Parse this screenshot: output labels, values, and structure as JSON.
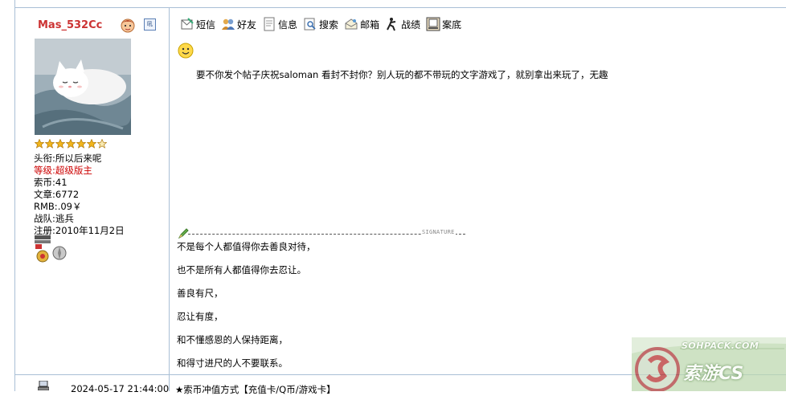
{
  "user": {
    "name": "Mas_532Cc",
    "stars": 7,
    "fields": [
      {
        "label": "头衔:",
        "value": "所以后来呢"
      },
      {
        "label": "等级:",
        "value": "超级版主"
      },
      {
        "label": "索币:",
        "value": "41"
      },
      {
        "label": "文章:",
        "value": "6772"
      },
      {
        "label": "RMB:",
        "value": ".09￥"
      },
      {
        "label": "战队:",
        "value": "逃兵"
      },
      {
        "label": "注册:",
        "value": "2010年11月2日"
      }
    ]
  },
  "toolbar": {
    "items": [
      {
        "label": "短信",
        "icon": "message-icon"
      },
      {
        "label": "好友",
        "icon": "friends-icon"
      },
      {
        "label": "信息",
        "icon": "info-icon"
      },
      {
        "label": "搜索",
        "icon": "search-icon"
      },
      {
        "label": "邮箱",
        "icon": "mail-icon"
      },
      {
        "label": "战绩",
        "icon": "record-icon"
      },
      {
        "label": "案底",
        "icon": "file-icon"
      }
    ]
  },
  "post": {
    "text": "要不你发个帖子庆祝saloman 看封不封你？别人玩的都不带玩的文字游戏了，就别拿出来玩了，无趣"
  },
  "signature": {
    "label": "SIGNATURE",
    "lines": [
      "不是每个人都值得你去善良对待，",
      "也不是所有人都值得你去忍让。",
      "善良有尺，",
      "忍让有度，",
      "和不懂感恩的人保持距离，",
      "和得寸进尺的人不要联系。"
    ]
  },
  "next_post": {
    "time": "2024-05-17 21:44:00",
    "text": "★索币冲值方式【充值卡/Q币/游戏卡】"
  },
  "watermark": {
    "line1": "SOHPACK.COM",
    "line2": "索游CS"
  },
  "colors": {
    "border": "#a9bfd6",
    "username": "#cc3333",
    "level": "#cc0000"
  }
}
